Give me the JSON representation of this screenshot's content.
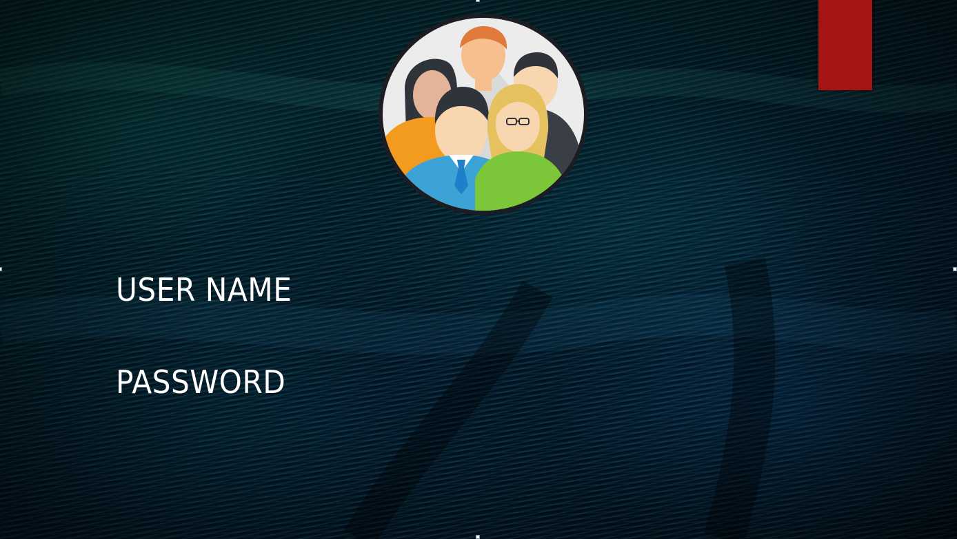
{
  "slide": {
    "background_description_color": "#05101a",
    "accent_color": "#a71414"
  },
  "header": {
    "avatar_icon": "group-of-people-icon"
  },
  "form": {
    "username_label": "USER NAME",
    "password_label": "PASSWORD"
  },
  "colors": {
    "text": "#ffffff",
    "tab": "#a71414",
    "orange_person": "#f29b1f",
    "blue_person": "#3ba3d6",
    "green_person": "#7cc63a",
    "tie": "#1f7fc8"
  }
}
